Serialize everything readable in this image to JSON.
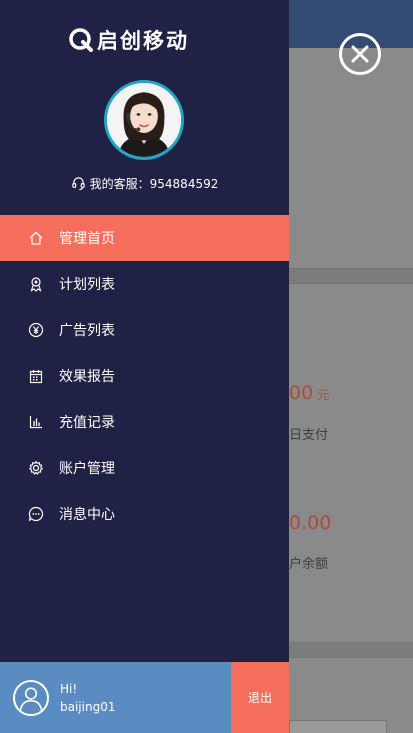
{
  "background": {
    "amount_1": "00",
    "amount_1_unit": "元",
    "caption_1": "日支付",
    "amount_2": "0.00",
    "caption_2": "户余额"
  },
  "drawer": {
    "brand": "启创移动",
    "service_label": "我的客服：954884592",
    "menu": [
      {
        "label": "管理首页",
        "icon": "home-icon",
        "active": true
      },
      {
        "label": "计划列表",
        "icon": "plan-icon",
        "active": false
      },
      {
        "label": "广告列表",
        "icon": "yen-icon",
        "active": false
      },
      {
        "label": "效果报告",
        "icon": "calendar-icon",
        "active": false
      },
      {
        "label": "充值记录",
        "icon": "bar-chart-icon",
        "active": false
      },
      {
        "label": "账户管理",
        "icon": "gear-icon",
        "active": false
      },
      {
        "label": "消息中心",
        "icon": "chat-icon",
        "active": false
      }
    ],
    "user": {
      "greeting": "Hi!",
      "username": "baijing01"
    },
    "logout_label": "退出"
  },
  "colors": {
    "drawer_bg": "#1f2245",
    "accent": "#f66e5c",
    "user_bar": "#5b8cc1",
    "avatar_ring": "#23a4c7"
  }
}
